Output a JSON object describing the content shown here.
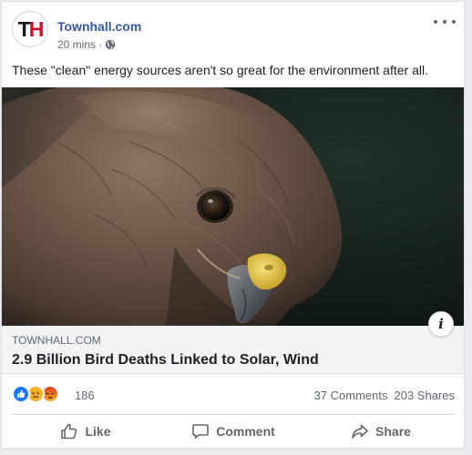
{
  "post": {
    "page_name": "Townhall.com",
    "avatar_text_t": "T",
    "avatar_text_h": "H",
    "timestamp": "20 mins",
    "separator": "·",
    "privacy_icon": "globe-icon",
    "more_icon": "more-horizontal-icon",
    "text": "These \"clean\" energy sources aren't so great for the environment after all."
  },
  "link_preview": {
    "domain": "TOWNHALL.COM",
    "title": "2.9 Billion Bird Deaths Linked to Solar, Wind",
    "image_icon": "hawk-photo",
    "info_label": "i"
  },
  "reactions": {
    "icons": [
      "like-icon",
      "sad-icon",
      "angry-icon"
    ],
    "count": "186",
    "comments": "37 Comments",
    "shares": "203 Shares"
  },
  "actions": {
    "like_label": "Like",
    "comment_label": "Comment",
    "share_label": "Share"
  },
  "colors": {
    "page_background": "#e9ebee",
    "link_blue": "#365899",
    "reaction_like": "#1877f2",
    "reaction_sad": "#f7b125",
    "reaction_angry": "#e9710f",
    "muted_text": "#606770"
  }
}
